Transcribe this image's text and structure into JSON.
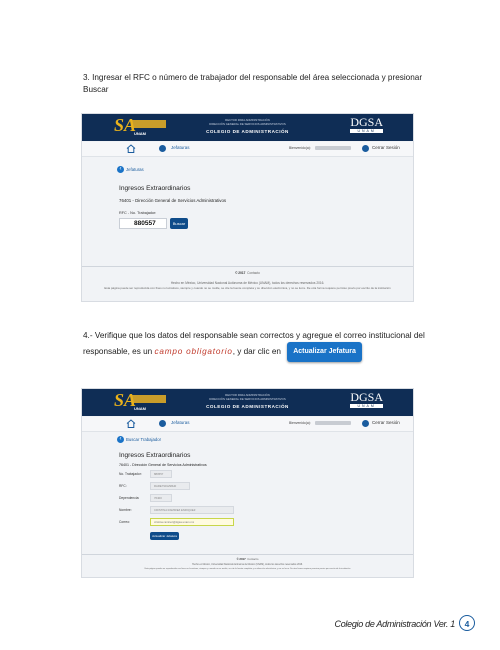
{
  "step3": {
    "text": "3. Ingresar el RFC o número de trabajador del responsable del área seleccionada y presionar Buscar"
  },
  "step4": {
    "text_before": "4.- Verifique que los datos del responsable sean correctos y agregue el correo institucional del responsable, es un ",
    "emphasis": "campo obligatorio",
    "text_after": ", y dar clic en",
    "button_label": "Actualizar Jefatura"
  },
  "app": {
    "header_tiny_1": "RECTOR PARA ADMINISTRACIÓN",
    "header_tiny_2": "DIRECCIÓN GENERAL DE SERVICIOS ADMINISTRATIVOS",
    "colegio": "COLEGIO DE ADMINISTRACIÓN",
    "dgsa": "DGSA",
    "dgsa_sub": "UNAM",
    "logo_letters": "SA",
    "logo_unam": "UNAM",
    "nav_jefaturas": "Jefaturas",
    "bienvenido": "Bienvenido(a):",
    "cerrar": "Cerrar Sesión",
    "footer_copy": "© 2017",
    "footer_contact": "Contacto",
    "footer_line1": "Hecho en México, Universidad Nacional Autónoma de México (UNAM), todos los derechos reservados 2016.",
    "footer_line2": "Esta página puede ser reproducida con fines no lucrativos, siempre y cuando no se mutile, se cite la fuente completa y su dirección electrónica, y no se lucre. De otra forma requiere permiso previo por escrito de la institución"
  },
  "screen1": {
    "back_label": "Jefaturas",
    "title": "Ingresos Extraordinarios",
    "subtitle": "76401 - Dirección General de Servicios Administrativos",
    "field_label": "RFC - No. Trabajador:",
    "field_value": "880557",
    "search_button": "Buscar"
  },
  "screen2": {
    "back_label": "Buscar Trabajador",
    "title": "Ingresos Extraordinarios",
    "subtitle": "76401 - Dirección General de Servicios Administrativos",
    "fields": [
      {
        "label": "No. Trabajador:",
        "value": "880557"
      },
      {
        "label": "RFC:",
        "value": "RARE7901298H0"
      },
      {
        "label": "Dependencia:",
        "value": "76400"
      },
      {
        "label": "Nombre:",
        "value": "CRISTINA RAMIREZ ENRIQUEZ"
      },
      {
        "label": "Correo:",
        "value": "cristina.ramirez@dgsa.unam.mx"
      }
    ],
    "update_button": "Actualizar Jefatura"
  },
  "page": {
    "footer_caption": "Colegio de Administración Ver. 1",
    "number": "4"
  },
  "colors": {
    "header": "#0f2d55",
    "accent": "#1a73c7",
    "gold": "#e9b21c",
    "emphasis": "#c0392b"
  }
}
